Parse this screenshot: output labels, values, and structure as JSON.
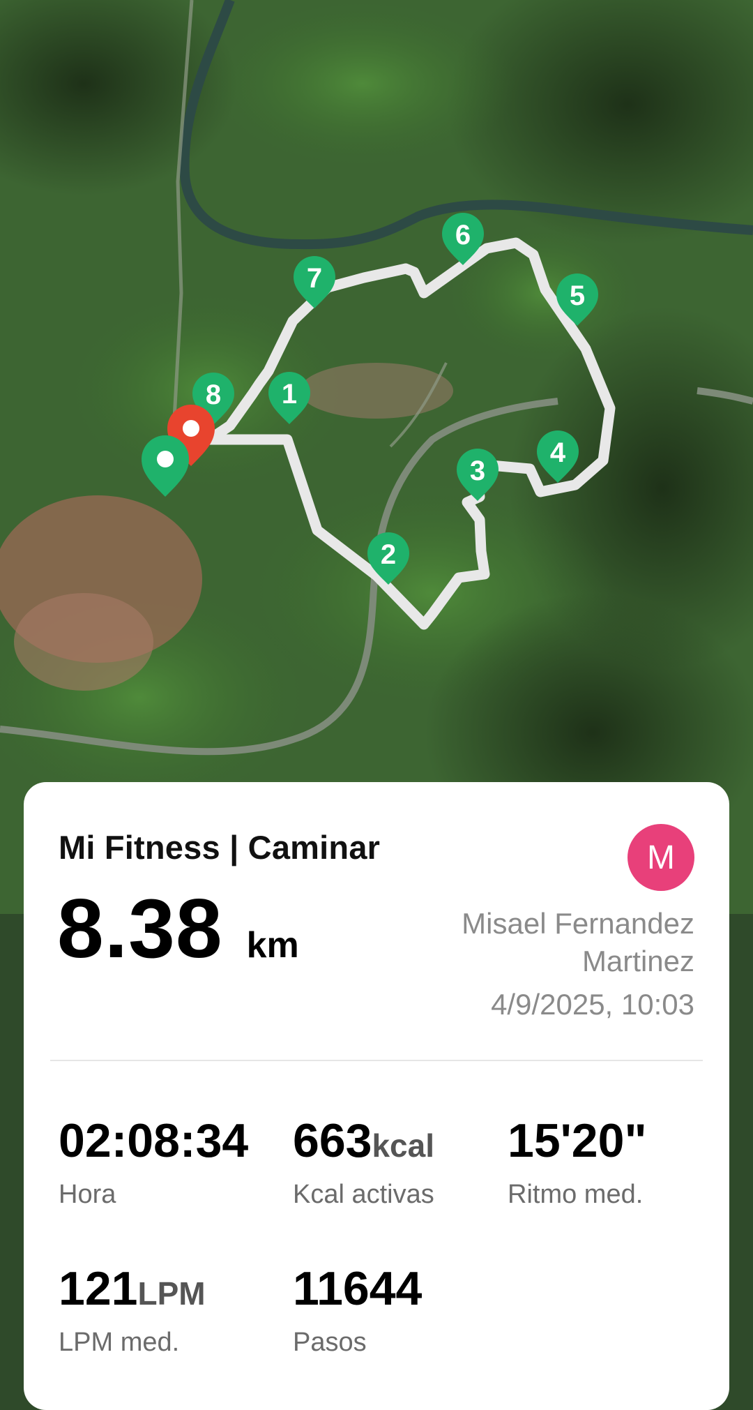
{
  "map": {
    "route_color": "#e8e8e8",
    "checkpoint_color": "#1fb26b",
    "start_marker_color": "#1fb26b",
    "end_marker_color": "#e8442e",
    "checkpoints": [
      "1",
      "2",
      "3",
      "4",
      "5",
      "6",
      "7",
      "8"
    ]
  },
  "card": {
    "title": "Mi Fitness | Caminar",
    "distance_value": "8.38",
    "distance_unit": "km",
    "avatar_initial": "M",
    "avatar_color": "#e8407a",
    "user_name": "Misael Fernandez Martinez",
    "date": "4/9/2025, 10:03"
  },
  "stats": [
    {
      "value": "02:08:34",
      "unit": "",
      "label": "Hora"
    },
    {
      "value": "663",
      "unit": "kcal",
      "label": "Kcal activas"
    },
    {
      "value": "15'20\"",
      "unit": "",
      "label": "Ritmo med."
    },
    {
      "value": "121",
      "unit": "LPM",
      "label": "LPM med."
    },
    {
      "value": "11644",
      "unit": "",
      "label": "Pasos"
    }
  ]
}
